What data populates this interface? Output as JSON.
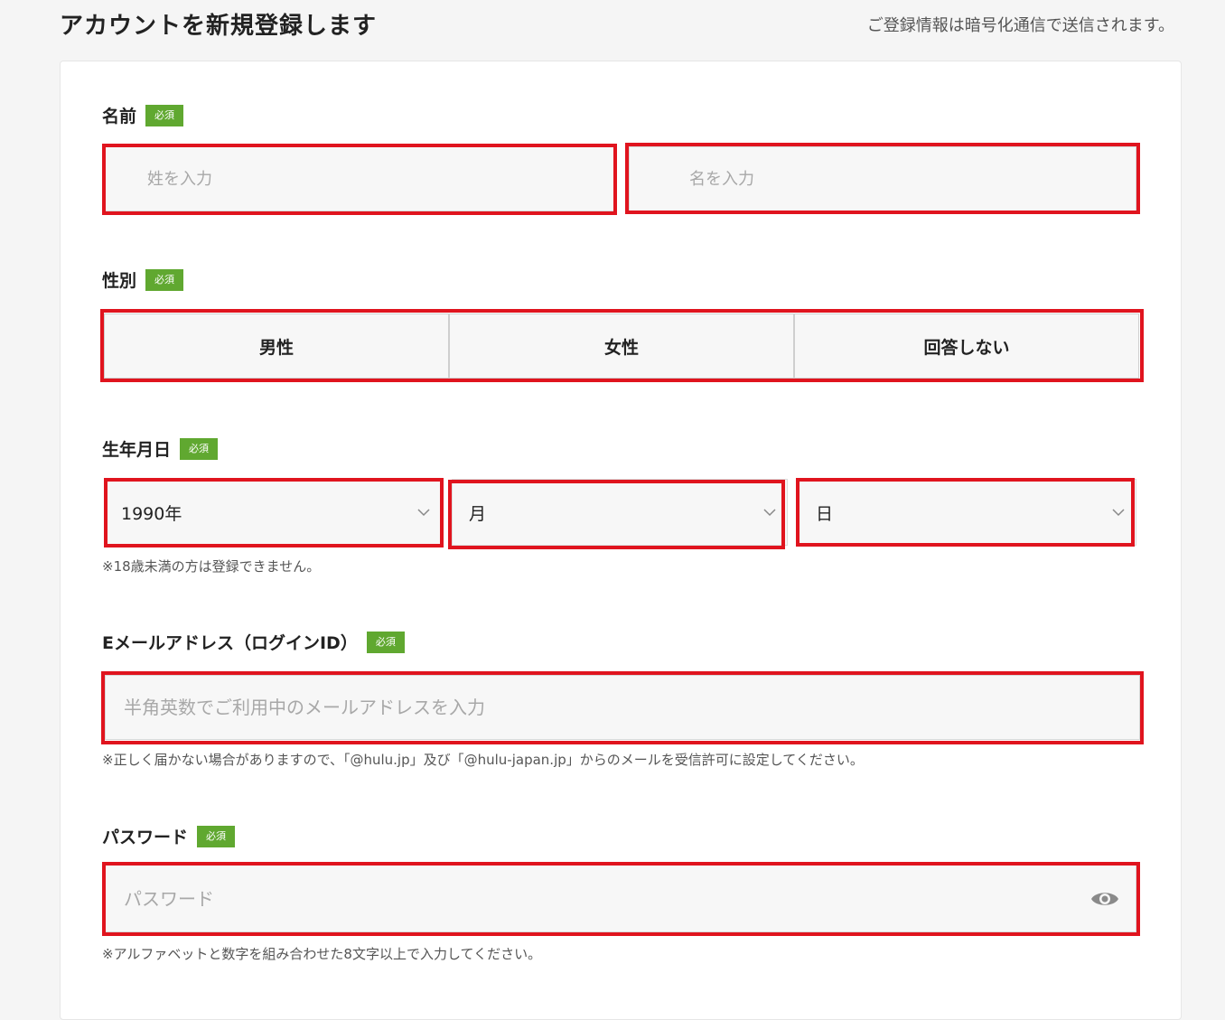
{
  "header": {
    "title": "アカウントを新規登録します",
    "note": "ご登録情報は暗号化通信で送信されます。"
  },
  "required_badge": "必須",
  "name": {
    "label": "名前",
    "last_placeholder": "姓を入力",
    "first_placeholder": "名を入力"
  },
  "gender": {
    "label": "性別",
    "options": [
      "男性",
      "女性",
      "回答しない"
    ]
  },
  "birthday": {
    "label": "生年月日",
    "year_value": "1990年",
    "month_value": "月",
    "day_value": "日",
    "note": "※18歳未満の方は登録できません。"
  },
  "email": {
    "label": "Eメールアドレス（ログインID）",
    "placeholder": "半角英数でご利用中のメールアドレスを入力",
    "note": "※正しく届かない場合がありますので、「@hulu.jp」及び「@hulu-japan.jp」からのメールを受信許可に設定してください。"
  },
  "password": {
    "label": "パスワード",
    "placeholder": "パスワード",
    "note": "※アルファベットと数字を組み合わせた8文字以上で入力してください。",
    "toggle_icon": "eye-icon"
  },
  "colors": {
    "highlight": "#e0141e",
    "badge": "#60a830"
  }
}
